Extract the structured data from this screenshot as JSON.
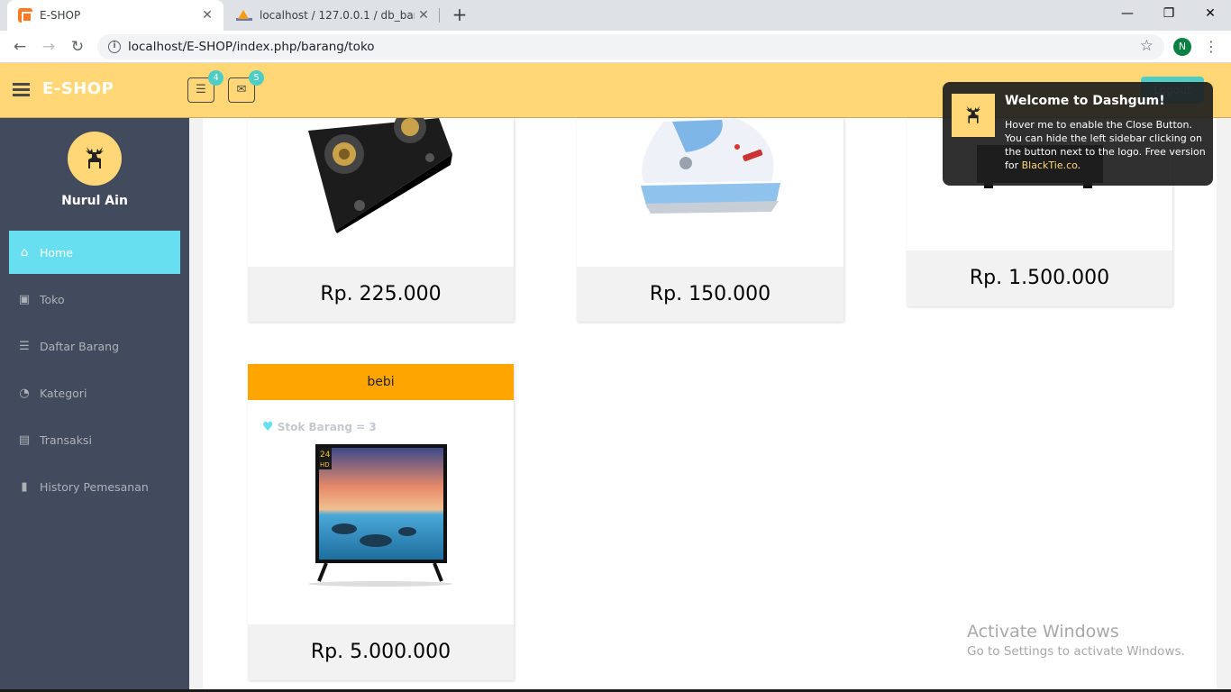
{
  "browser": {
    "tabs": [
      {
        "title": "E-SHOP",
        "close": "✕"
      },
      {
        "title": "localhost / 127.0.0.1 / db_barang",
        "close": "✕"
      }
    ],
    "new_tab": "+",
    "window": {
      "minimize": "—",
      "restore": "❐",
      "close": "✕"
    },
    "url": "localhost/E-SHOP/index.php/barang/toko",
    "profile_initial": "N"
  },
  "header": {
    "brand": "E-SHOP",
    "tasks_badge": "4",
    "inbox_badge": "5",
    "logout_label": "Logout"
  },
  "sidebar": {
    "username": "Nurul Ain",
    "items": [
      {
        "label": "Home",
        "icon": "home-icon",
        "glyph": "⌂"
      },
      {
        "label": "Toko",
        "icon": "briefcase-icon",
        "glyph": "▣"
      },
      {
        "label": "Daftar Barang",
        "icon": "list-icon",
        "glyph": "☰"
      },
      {
        "label": "Kategori",
        "icon": "dashboard-icon",
        "glyph": "◔"
      },
      {
        "label": "Transaksi",
        "icon": "money-icon",
        "glyph": "▤"
      },
      {
        "label": "History Pemesanan",
        "icon": "bookmark-icon",
        "glyph": "▮"
      }
    ]
  },
  "products": [
    {
      "price": "Rp. 225.000",
      "image": "gas-stove"
    },
    {
      "price": "Rp. 150.000",
      "image": "iron"
    },
    {
      "price": "Rp. 1.500.000",
      "image": "appliance"
    },
    {
      "category": "bebi",
      "stock": "Stok Barang = 3",
      "price": "Rp. 5.000.000",
      "image": "television",
      "tv_badge": "24",
      "tv_badge2": "HD"
    }
  ],
  "notification": {
    "title": "Welcome to Dashgum!",
    "text": "Hover me to enable the Close Button. You can hide the left sidebar clicking on the button next to the logo. Free version for ",
    "link": "BlackTie.co",
    "end": "."
  },
  "watermark": {
    "line1": "Activate Windows",
    "line2": "Go to Settings to activate Windows."
  },
  "colors": {
    "header": "#ffd777",
    "sidebar": "#424a5d",
    "active": "#68dff0",
    "category": "#ffa500"
  }
}
